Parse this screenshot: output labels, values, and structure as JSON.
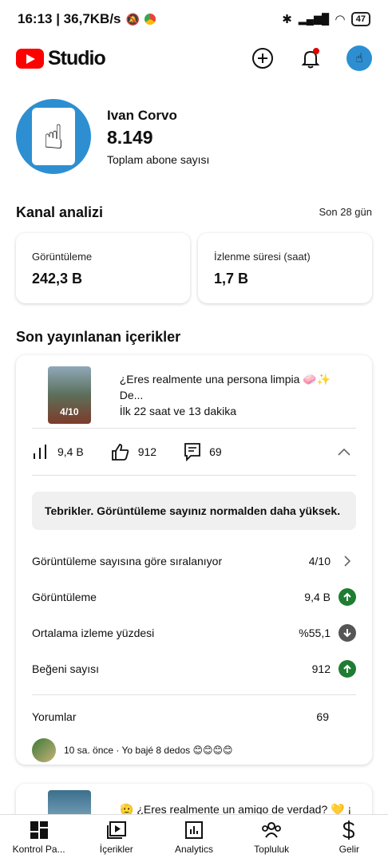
{
  "status": {
    "time_speed": "16:13 | 36,7KB/s",
    "battery": "47"
  },
  "brand": {
    "name": "Studio"
  },
  "channel": {
    "name": "Ivan Corvo",
    "subscribers": "8.149",
    "subscribers_label": "Toplam abone sayısı"
  },
  "analytics": {
    "title": "Kanal analizi",
    "period": "Son 28 gün",
    "metrics": [
      {
        "label": "Görüntüleme",
        "value": "242,3 B"
      },
      {
        "label": "İzlenme süresi (saat)",
        "value": "1,7 B"
      }
    ]
  },
  "recent": {
    "title": "Son yayınlanan içerikler",
    "video": {
      "thumb_label": "4/10",
      "title": "¿Eres realmente una persona limpia 🧼✨ De...",
      "age": "İlk 22 saat ve 13 dakika",
      "views": "9,4 B",
      "likes": "912",
      "comments": "69",
      "notice": "Tebrikler. Görüntüleme sayınız normalden daha yüksek.",
      "details": [
        {
          "label": "Görüntüleme sayısına göre sıralanıyor",
          "value": "4/10"
        },
        {
          "label": "Görüntüleme",
          "value": "9,4 B"
        },
        {
          "label": "Ortalama izleme yüzdesi",
          "value": "%55,1"
        },
        {
          "label": "Beğeni sayısı",
          "value": "912"
        }
      ],
      "comments_label": "Yorumlar",
      "comments_count": "69",
      "latest_comment": "10 sa. önce · Yo bajé 8 dedos 😊😊😊😊"
    },
    "next_video_title": "🫡 ¿Eres realmente un amigo de verdad? 💛 ¡"
  },
  "nav": [
    {
      "label": "Kontrol Pa..."
    },
    {
      "label": "İçerikler"
    },
    {
      "label": "Analytics"
    },
    {
      "label": "Topluluk"
    },
    {
      "label": "Gelir"
    }
  ]
}
